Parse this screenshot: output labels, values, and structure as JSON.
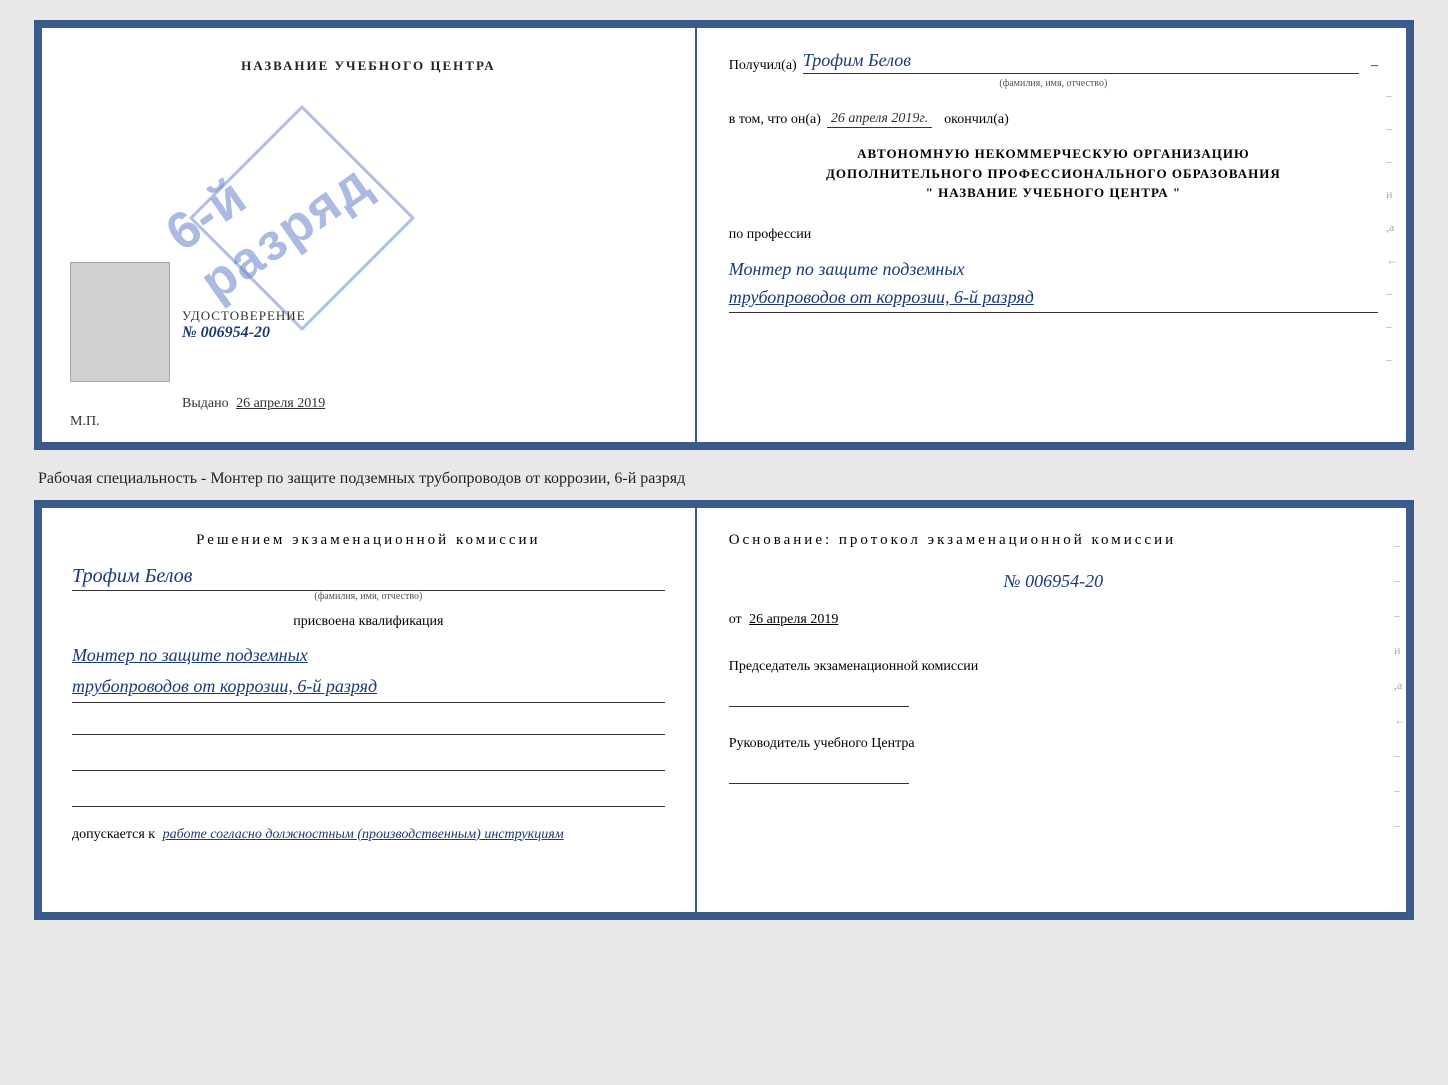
{
  "top_cert": {
    "left": {
      "title": "НАЗВАНИЕ УЧЕБНОГО ЦЕНТРА",
      "udostoverenie_label": "УДОСТОВЕРЕНИЕ",
      "cert_number": "№ 006954-20",
      "stamp_line1": "6-й",
      "stamp_line2": "разряд",
      "vydano_label": "Выдано",
      "vydano_date": "26 апреля 2019",
      "mp_label": "М.П."
    },
    "right": {
      "poluchil_label": "Получил(а)",
      "poluchil_name": "Трофим Белов",
      "poluchil_sub": "(фамилия, имя, отчество)",
      "vtom_label": "в том, что он(а)",
      "vtom_date": "26 апреля 2019г.",
      "okonchil_label": "окончил(а)",
      "org_line1": "АВТОНОМНУЮ НЕКОММЕРЧЕСКУЮ ОРГАНИЗАЦИЮ",
      "org_line2": "ДОПОЛНИТЕЛЬНОГО ПРОФЕССИОНАЛЬНОГО ОБРАЗОВАНИЯ",
      "org_name_left": "\"",
      "org_name": "НАЗВАНИЕ УЧЕБНОГО ЦЕНТРА",
      "org_name_right": "\"",
      "po_professii": "по профессии",
      "professiya_line1": "Монтер по защите подземных",
      "professiya_line2": "трубопроводов от коррозии, 6-й разряд",
      "dash_items": [
        "-",
        "-",
        "-",
        "и",
        ",а",
        "←",
        "-",
        "-",
        "-"
      ]
    }
  },
  "specialty_label": "Рабочая специальность - Монтер по защите подземных трубопроводов от коррозии, 6-й разряд",
  "bottom_cert": {
    "left": {
      "decision_title": "Решением  экзаменационной  комиссии",
      "name": "Трофим Белов",
      "name_sub": "(фамилия, имя, отчество)",
      "prisvoena_label": "присвоена квалификация",
      "qualification_line1": "Монтер по защите подземных",
      "qualification_line2": "трубопроводов от коррозии, 6-й разряд",
      "blank_lines": [
        "",
        "",
        ""
      ],
      "dopuskaetsya_prefix": "допускается к",
      "dopuskaetsya_text": "работе согласно должностным (производственным) инструкциям"
    },
    "right": {
      "osnovanie_title": "Основание: протокол  экзаменационной  комиссии",
      "protocol_number": "№  006954-20",
      "ot_prefix": "от",
      "ot_date": "26 апреля 2019",
      "predsedatel_label": "Председатель экзаменационной комиссии",
      "rukovoditel_label": "Руководитель учебного Центра",
      "dash_items": [
        "-",
        "-",
        "-",
        "и",
        ",а",
        "←",
        "-",
        "-",
        "-"
      ]
    }
  }
}
